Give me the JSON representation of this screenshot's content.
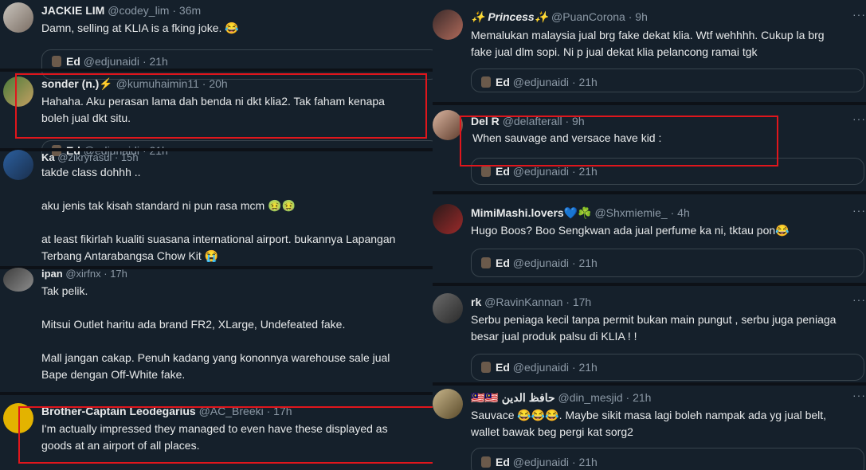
{
  "left": {
    "tweets": [
      {
        "name": "JACKIE LIM",
        "handle": "@codey_lim",
        "time": "· 36m",
        "lines": [
          "Damn, selling at KLIA is a fking joke. 😂"
        ],
        "quote": {
          "name": "Ed",
          "handle": "@edjunaidi",
          "time": "· 21h"
        }
      },
      {
        "name": "sonder (n.)⚡",
        "handle": "@kumuhaimin11",
        "time": "· 20h",
        "lines": [
          "Hahaha. Aku perasan lama dah benda ni dkt klia2. Tak faham kenapa",
          "boleh jual dkt situ."
        ],
        "quote": {
          "name": "Ed",
          "handle": "@edjunaidi",
          "time": "· 21h"
        }
      },
      {
        "name": "Ka",
        "handle": "@zikryrasul",
        "time": "· 15h",
        "lines": [
          "takde class dohhh ..",
          "",
          "aku jenis tak kisah standard ni pun rasa mcm 🤢🤢",
          "",
          "at least fikirlah kualiti suasana international airport. bukannya Lapangan",
          "Terbang Antarabangsa Chow Kit 😭"
        ]
      },
      {
        "name": "ipan",
        "handle": "@xirfnx",
        "time": "· 17h",
        "lines": [
          "Tak pelik.",
          "",
          "Mitsui Outlet haritu ada brand FR2, XLarge, Undefeated fake.",
          "",
          "Mall jangan cakap. Penuh kadang yang kononnya warehouse sale jual",
          "Bape dengan Off-White fake."
        ]
      },
      {
        "name": "Brother-Captain Leodegarius",
        "handle": "@AC_Breeki",
        "time": "· 17h",
        "lines": [
          "I'm actually impressed they managed to even have these displayed as",
          "goods at an airport of all places."
        ]
      }
    ]
  },
  "right": {
    "tweets": [
      {
        "name": "✨ Princess✨",
        "handle": "@PuanCorona",
        "time": "· 9h",
        "lines": [
          "Memalukan malaysia jual brg fake dekat klia. Wtf wehhhh. Cukup la brg",
          "fake jual dlm sopi. Ni p jual dekat klia pelancong ramai tgk"
        ],
        "quote": {
          "name": "Ed",
          "handle": "@edjunaidi",
          "time": "· 21h"
        }
      },
      {
        "name": "Del R",
        "handle": "@delafterall",
        "time": "· 9h",
        "lines": [
          "When sauvage and versace have kid :"
        ],
        "quote": {
          "name": "Ed",
          "handle": "@edjunaidi",
          "time": "· 21h"
        }
      },
      {
        "name": "MimiMashi.lovers💙☘️",
        "handle": "@Shxmiemie_",
        "time": "· 4h",
        "lines": [
          "Hugo Boos? Boo Sengkwan ada jual perfume ka ni, tktau pon😂"
        ],
        "quote": {
          "name": "Ed",
          "handle": "@edjunaidi",
          "time": "· 21h"
        }
      },
      {
        "name": "rk",
        "handle": "@RavinKannan",
        "time": "· 17h",
        "lines": [
          "Serbu peniaga kecil tanpa permit bukan main pungut , serbu juga peniaga",
          "besar jual produk palsu di KLIA ! !"
        ],
        "quote": {
          "name": "Ed",
          "handle": "@edjunaidi",
          "time": "· 21h"
        }
      },
      {
        "name": "🇲🇾🇲🇾 حافظ الدين",
        "handle": "@din_mesjid",
        "time": "· 21h",
        "lines": [
          "Sauvace 😂😂😂. Maybe sikit masa lagi boleh nampak ada yg jual belt,",
          "wallet bawak beg pergi kat sorg2"
        ],
        "quote": {
          "name": "Ed",
          "handle": "@edjunaidi",
          "time": "· 21h"
        }
      }
    ],
    "more_label": "···"
  },
  "colors": {
    "highlight": "#e0161c",
    "background": "#15202b",
    "muted": "#8b98a5",
    "text": "#e7e9ea"
  }
}
